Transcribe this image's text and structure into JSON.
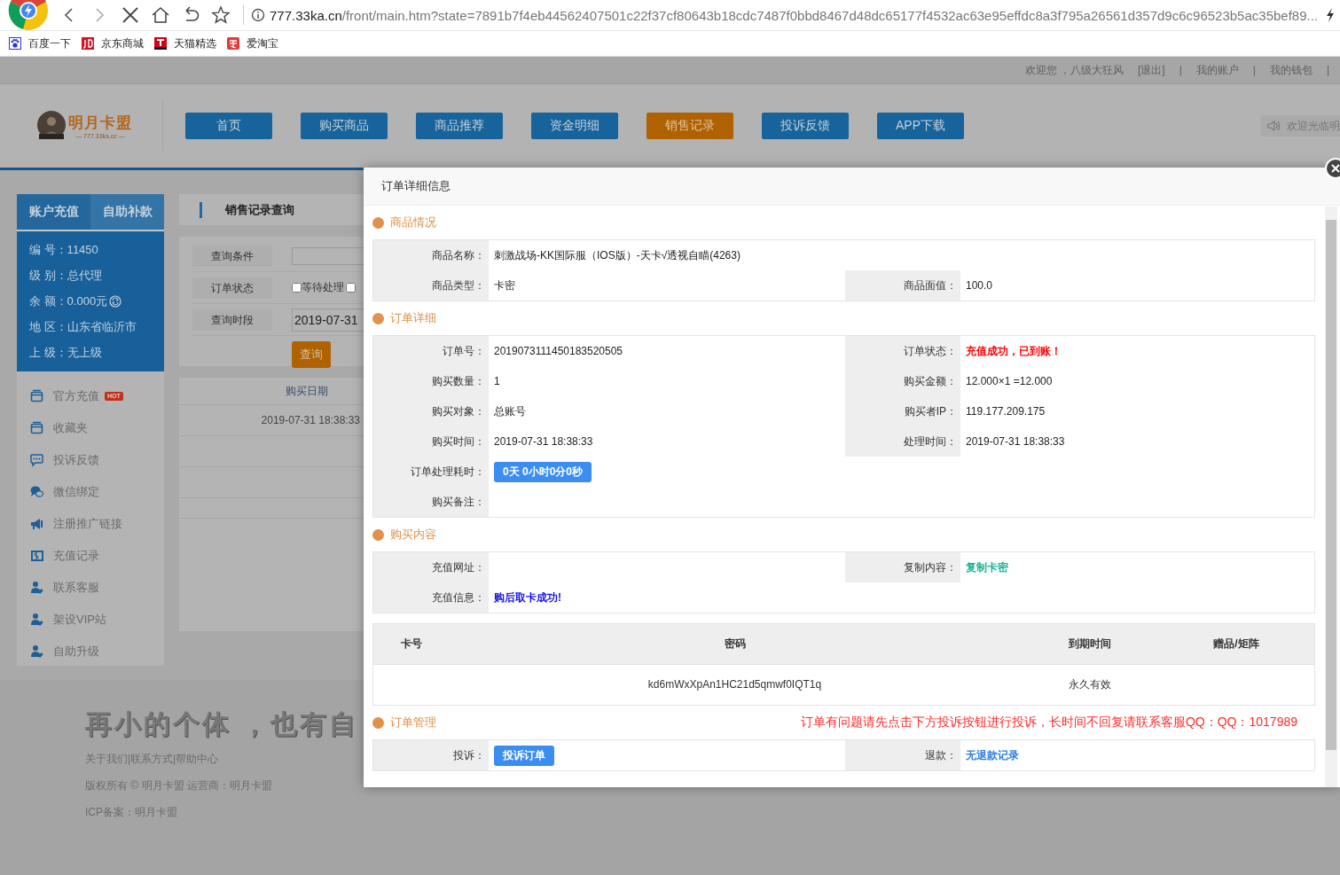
{
  "browser": {
    "url_host": "777.33ka.cn",
    "url_path": "/front/main.htm?state=7891b7f4eb44562407501c22f37cf80643b18cdc7487f0bbd8467d48dc65177f4532ac63e95effdc8a3f795a26561d357d9c6c96523b5ac35bef89...",
    "bookmarks": [
      {
        "label": "百度一下",
        "kind": "paw"
      },
      {
        "label": "京东商城",
        "kind": "jd"
      },
      {
        "label": "天猫精选",
        "kind": "tmall"
      },
      {
        "label": "爱淘宝",
        "kind": "taobao"
      }
    ]
  },
  "top_bar": {
    "greeting": "欢迎您 ，八级大狂风",
    "separator": "|",
    "links": [
      "[退出]",
      "我的账户",
      "我的钱包"
    ]
  },
  "header": {
    "logo_title": "明月卡盟",
    "logo_subtitle": "— 777.33ka.cc —",
    "nav": [
      {
        "label": "首页",
        "selected": false
      },
      {
        "label": "购买商品",
        "selected": false
      },
      {
        "label": "商品推荐",
        "selected": false
      },
      {
        "label": "资金明细",
        "selected": false
      },
      {
        "label": "销售记录",
        "selected": true
      },
      {
        "label": "投诉反馈",
        "selected": false
      },
      {
        "label": "APP下载",
        "selected": false
      }
    ],
    "notice": "欢迎光临明"
  },
  "sidebar": {
    "tabs": [
      {
        "label": "账户充值",
        "selected": true
      },
      {
        "label": "自助补款",
        "selected": false
      }
    ],
    "info": [
      {
        "text": "编 号：11450"
      },
      {
        "text": "级 别：总代理"
      },
      {
        "text": "余 额：0.000元",
        "refresh": true
      },
      {
        "text": "地 区：山东省临沂市"
      },
      {
        "text": "上 级：无上级"
      }
    ],
    "menu": [
      {
        "label": "官方充值",
        "kind": "card",
        "badge": "HOT"
      },
      {
        "label": "收藏夹",
        "kind": "card"
      },
      {
        "label": "投诉反馈",
        "kind": "chat"
      },
      {
        "label": "微信绑定",
        "kind": "bubbles"
      },
      {
        "label": "注册推广链接",
        "kind": "speaker"
      },
      {
        "label": "充值记录",
        "kind": "money"
      },
      {
        "label": "联系客服",
        "kind": "person"
      },
      {
        "label": "架设VIP站",
        "kind": "person"
      },
      {
        "label": "自助升级",
        "kind": "person"
      }
    ]
  },
  "query_panel": {
    "title": "销售记录查询",
    "fields": [
      {
        "kind": "text",
        "label": "查询条件"
      },
      {
        "kind": "checkboxes",
        "label": "订单状态",
        "options": [
          {
            "label": "等待处理",
            "checked": false
          },
          {
            "checked": false
          }
        ]
      },
      {
        "kind": "date",
        "label": "查询时段",
        "value": "2019-07-31"
      }
    ],
    "button": "查询",
    "table": {
      "columns": [
        "购买日期"
      ],
      "rows": [
        [
          "2019-07-31 18:38:33"
        ]
      ]
    }
  },
  "footer": {
    "slogan": "再小的个体 ，也有自",
    "links": "关于我们|联系方式|帮助中心",
    "copyright": "版权所有 © 明月卡盟 运营商：明月卡盟",
    "icp": "ICP备案：明月卡盟"
  },
  "modal": {
    "title": "订单详细信息",
    "sections": [
      {
        "kind": "info",
        "title": "商品情况",
        "rows": [
          [
            {
              "label": "商品名称：",
              "value": "刺激战场-KK国际服（IOS版）-天卡√透视自瞄(4263)",
              "kind": "text"
            }
          ],
          [
            {
              "label": "商品类型：",
              "value": "卡密",
              "kind": "text"
            },
            {
              "label": "商品面值：",
              "value": "100.0",
              "kind": "text"
            }
          ]
        ]
      },
      {
        "kind": "info",
        "title": "订单详细",
        "rows": [
          [
            {
              "label": "订单号：",
              "value": "2019073111450183520505",
              "kind": "text"
            },
            {
              "label": "订单状态：",
              "value": "充值成功，已到账！",
              "kind": "status"
            }
          ],
          [
            {
              "label": "购买数量：",
              "value": "1",
              "kind": "text"
            },
            {
              "label": "购买金额：",
              "value": "12.000×1 =12.000",
              "kind": "text"
            }
          ],
          [
            {
              "label": "购买对象：",
              "value": "总账号",
              "kind": "text"
            },
            {
              "label": "购买者IP：",
              "value": "119.177.209.175",
              "kind": "text"
            }
          ],
          [
            {
              "label": "购买时间：",
              "value": "2019-07-31 18:38:33",
              "kind": "text"
            },
            {
              "label": "处理时间：",
              "value": "2019-07-31 18:38:33",
              "kind": "text"
            }
          ],
          [
            {
              "label": "订单处理耗时：",
              "value": "0天 0小时0分0秒",
              "kind": "badge"
            }
          ],
          [
            {
              "label": "购买备注："
            }
          ]
        ]
      },
      {
        "kind": "info",
        "title": "购买内容",
        "rows": [
          [
            {
              "label": "充值网址："
            },
            {
              "label": "复制内容：",
              "value": "复制卡密",
              "kind": "copy"
            }
          ],
          [
            {
              "label": "充值信息：",
              "value": "购后取卡成功!",
              "kind": "message"
            }
          ]
        ]
      },
      {
        "kind": "cards",
        "columns": [
          "卡号",
          "密码",
          "到期时间",
          "赠品/矩阵"
        ],
        "rows": [
          {
            "password": "kd6mWxXpAn1HC21d5qmwf0IQT1q",
            "expiry": "永久有效"
          }
        ]
      },
      {
        "kind": "info",
        "title": "订单管理",
        "notice": "订单有问题请先点击下方投诉按钮进行投诉，长时间不回复请联系客服QQ：QQ：1017989",
        "rows": [
          [
            {
              "label": "投诉：",
              "value": "投诉订单",
              "kind": "button"
            },
            {
              "label": "退款：",
              "value": "无退款记录",
              "kind": "link"
            }
          ]
        ]
      }
    ]
  }
}
